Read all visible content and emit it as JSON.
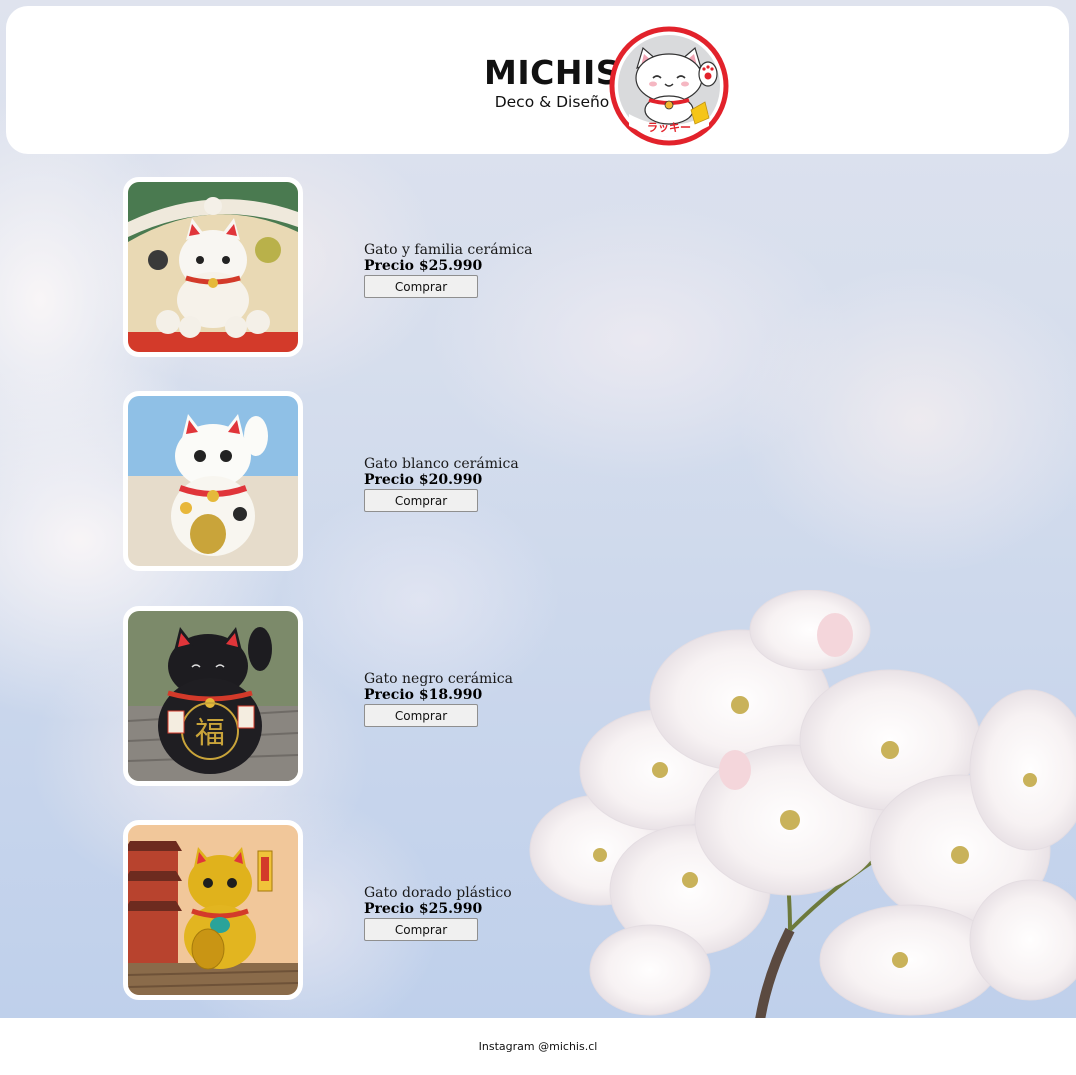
{
  "brand": {
    "name": "MICHIS",
    "tagline": "Deco & Diseño",
    "logo_text": "ラッキー"
  },
  "products": [
    {
      "name": "Gato y familia cerámica",
      "price": "Precio $25.990",
      "button": "Comprar",
      "image": "lucky-cat-family-photo"
    },
    {
      "name": "Gato blanco cerámica",
      "price": "Precio $20.990",
      "button": "Comprar",
      "image": "white-lucky-cat-photo"
    },
    {
      "name": "Gato negro cerámica",
      "price": "Precio $18.990",
      "button": "Comprar",
      "image": "black-lucky-cat-photo"
    },
    {
      "name": "Gato dorado plástico",
      "price": "Precio $25.990",
      "button": "Comprar",
      "image": "gold-lucky-cat-photo"
    }
  ],
  "footer": {
    "text": "Instagram @michis.cl"
  },
  "colors": {
    "logo_ring": "#e2222b",
    "page_bg_sky": "#c9d6ec",
    "button_bg": "#f0f0f0"
  }
}
